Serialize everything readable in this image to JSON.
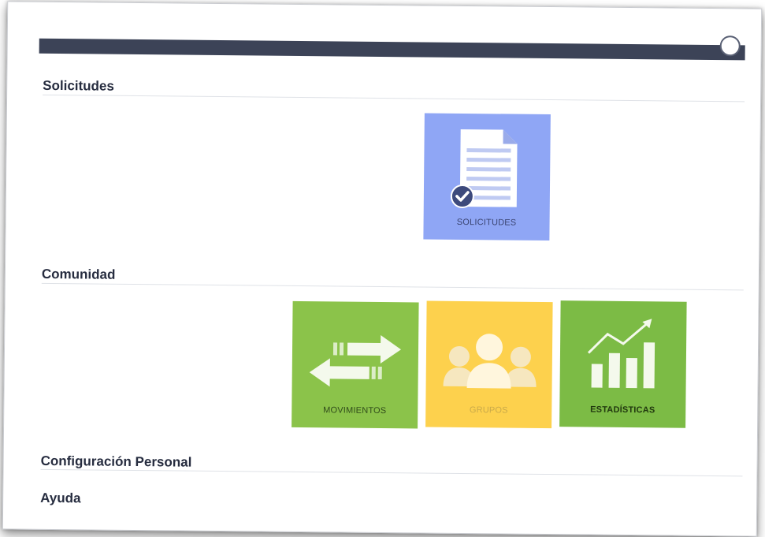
{
  "sections": [
    {
      "title": "Solicitudes"
    },
    {
      "title": "Comunidad"
    },
    {
      "title": "Configuración Personal"
    },
    {
      "title": "Ayuda"
    }
  ],
  "tiles": {
    "solicitudes": {
      "label": "SOLICITUDES",
      "icon": "document-check-icon",
      "color": "#8fa6f5"
    },
    "movimientos": {
      "label": "MOVIMIENTOS",
      "icon": "transfer-arrows-icon",
      "color": "#8bc34a"
    },
    "grupos": {
      "label": "GRUPOS",
      "icon": "people-group-icon",
      "color": "#fdd14d"
    },
    "estadisticas": {
      "label": "ESTADÍSTICAS",
      "icon": "bar-chart-trend-icon",
      "color": "#7cbb45"
    }
  }
}
